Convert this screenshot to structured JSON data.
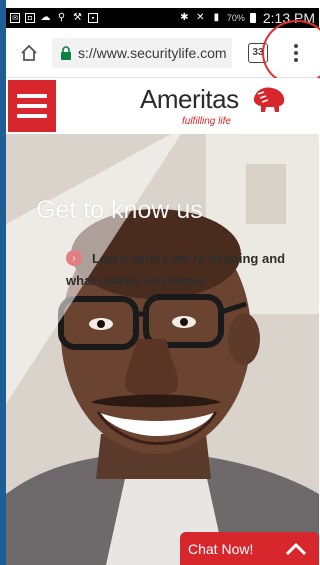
{
  "status_bar": {
    "battery_percent": "70%",
    "time": "2:13 PM",
    "icons": [
      "notification-icon",
      "notification-icon",
      "cloud-icon",
      "usb-icon",
      "wrench-icon",
      "screenshot-icon",
      "bluetooth-icon",
      "mute-icon",
      "lte-signal-icon",
      "battery-icon"
    ]
  },
  "browser": {
    "url": "s://www.securitylife.com",
    "tab_count": "33"
  },
  "site": {
    "logo_name": "Ameritas",
    "logo_tagline": "fulfilling life",
    "brand_color": "#d8262d"
  },
  "hero": {
    "headline": "Get to know us",
    "link_text": "Learn where we're heading and what makes us unique"
  },
  "chat": {
    "label": "Chat Now!"
  }
}
